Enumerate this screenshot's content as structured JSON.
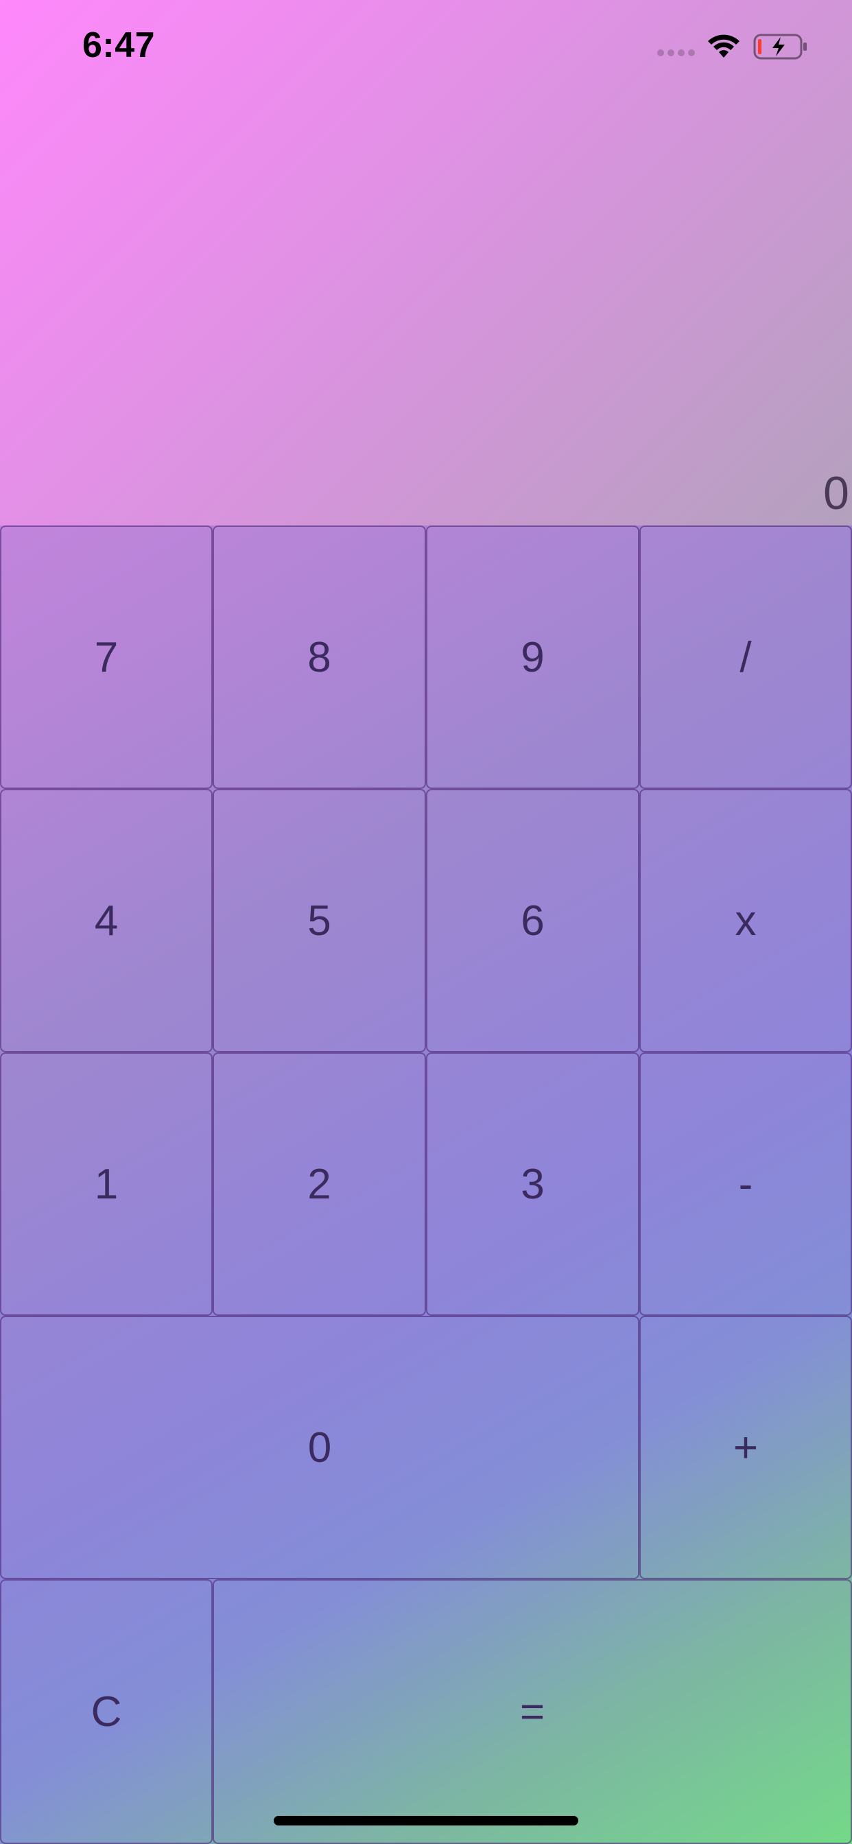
{
  "status_bar": {
    "time": "6:47",
    "icons": [
      "signal-dots-icon",
      "wifi-icon",
      "battery-charging-icon"
    ],
    "battery_color": "#ff3b30"
  },
  "display": {
    "value": "0"
  },
  "keys": {
    "seven": "7",
    "eight": "8",
    "nine": "9",
    "divide": "/",
    "four": "4",
    "five": "5",
    "six": "6",
    "multiply": "x",
    "one": "1",
    "two": "2",
    "three": "3",
    "subtract": "-",
    "zero": "0",
    "add": "+",
    "clear": "C",
    "equals": "="
  },
  "colors": {
    "gradient_start": "#ff88fb",
    "gradient_end": "#6fd884",
    "text": "#3b2a5e"
  }
}
